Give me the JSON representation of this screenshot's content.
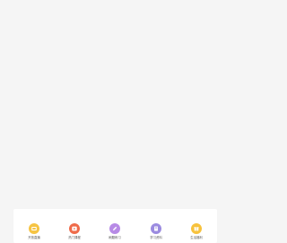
{
  "quick_nav": {
    "items": [
      {
        "label": "开放直播",
        "icon": "live-tv-icon",
        "color": "#F6C443"
      },
      {
        "label": "热门课程",
        "icon": "play-course-icon",
        "color": "#EF6B4A"
      },
      {
        "label": "刷题练习",
        "icon": "pencil-practice-icon",
        "color": "#B78AE6"
      },
      {
        "label": "学习资料",
        "icon": "document-material-icon",
        "color": "#9B8BE0"
      },
      {
        "label": "生活福利",
        "icon": "gift-welfare-icon",
        "color": "#F7C23D"
      }
    ]
  }
}
